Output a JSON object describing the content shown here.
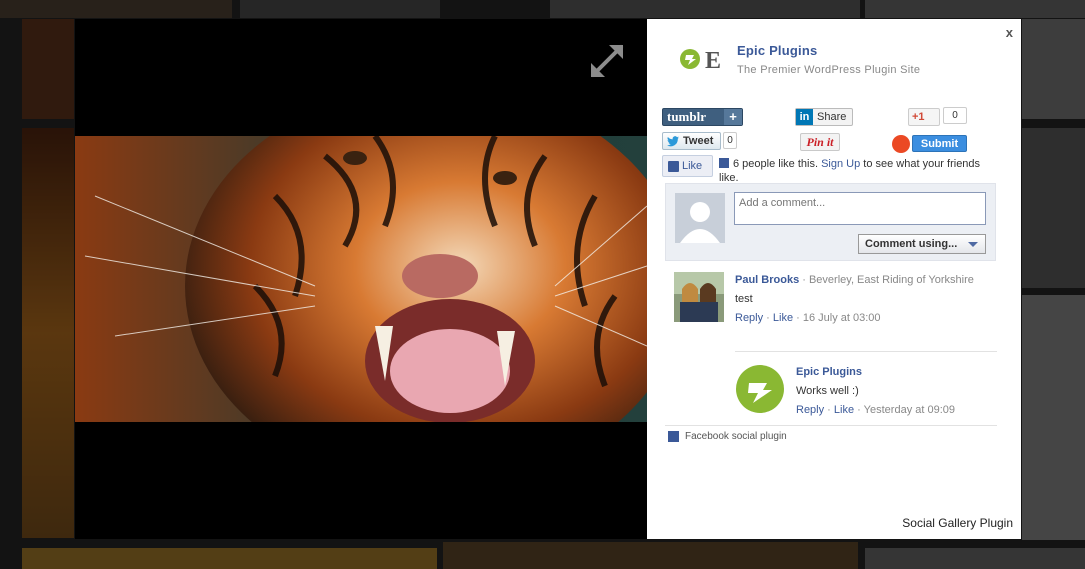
{
  "page": {
    "brand": {
      "name": "Epic Plugins",
      "tagline": "The Premier WordPress Plugin Site",
      "accent_color": "#3b5998",
      "logo_letter": "E",
      "logo_color": "#8ab833"
    },
    "close_label": "x",
    "share": {
      "tumblr_label": "tumblr",
      "tumblr_plus": "+",
      "linkedin_label": "Share",
      "linkedin_icon": "in",
      "gplus_label": "+1",
      "gplus_count": "0",
      "tweet_label": "Tweet",
      "tweet_count": "0",
      "pinit_label": "Pin it",
      "stumbleupon_label": "Submit"
    },
    "fb_like": {
      "button_label": "Like",
      "count_text": "6 people like this.",
      "signup_link": "Sign Up",
      "suffix_text": " to see what your friends like."
    },
    "comment_form": {
      "placeholder": "Add a comment...",
      "comment_using": "Comment using..."
    },
    "comments": [
      {
        "name": "Paul Brooks",
        "location": " · Beverley, East Riding of Yorkshire",
        "text": "test",
        "reply": "Reply",
        "like": "Like",
        "timestamp": "16 July at 03:00"
      },
      {
        "name": "Epic Plugins",
        "text": "Works well :)",
        "reply": "Reply",
        "like": "Like",
        "timestamp": "Yesterday at 09:09"
      }
    ],
    "fb_plugin_footer": "Facebook social plugin",
    "gallery_credit": "Social Gallery Plugin"
  }
}
